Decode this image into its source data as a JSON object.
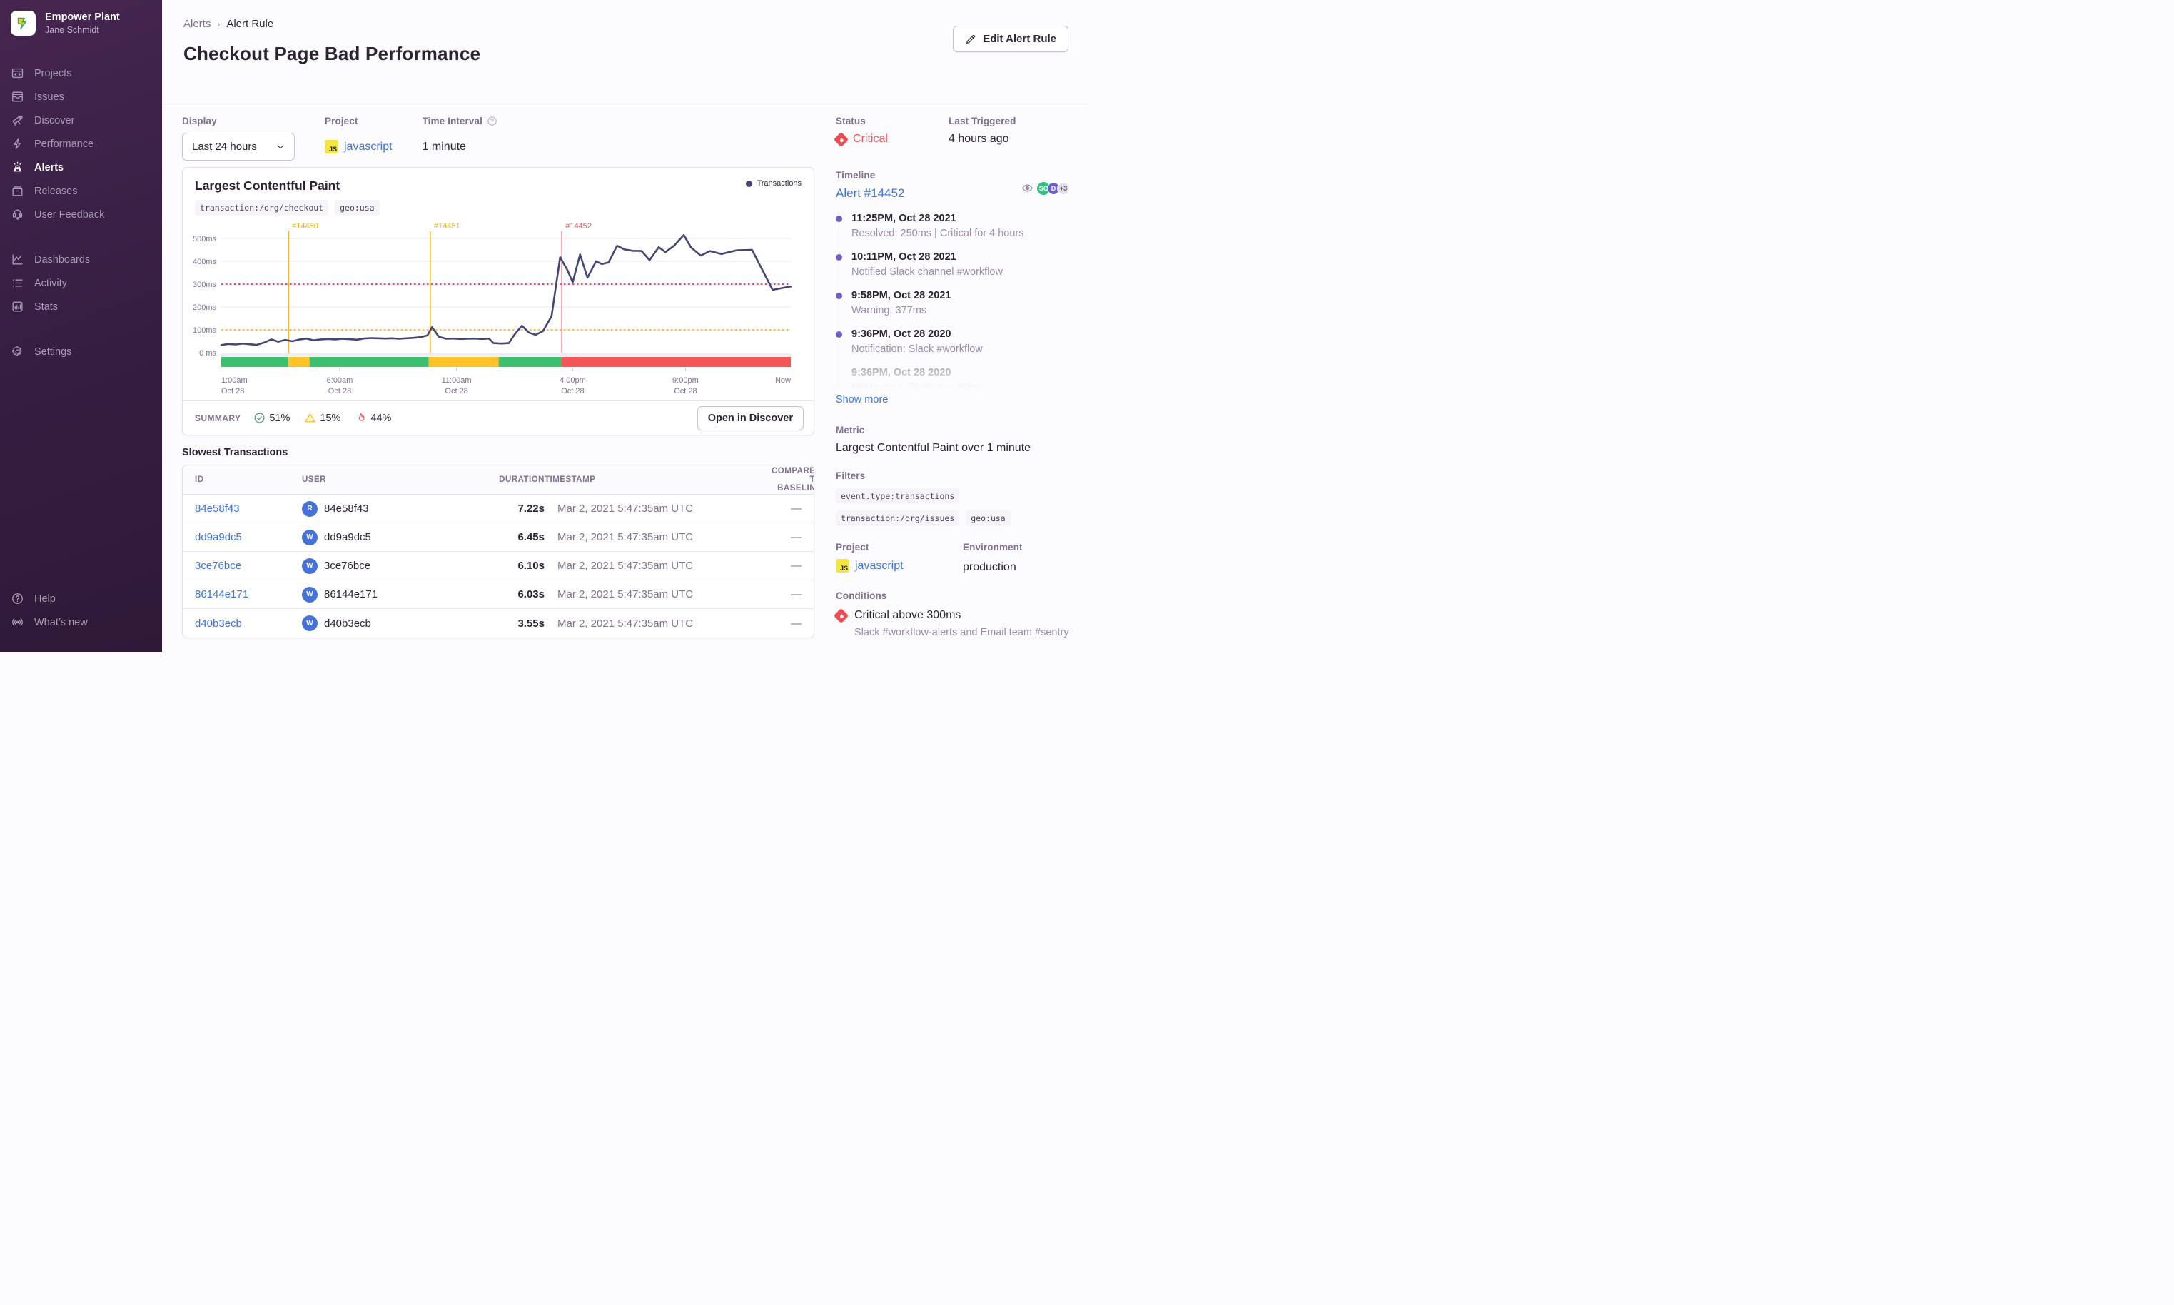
{
  "sidebar": {
    "org_name": "Empower Plant",
    "user_name": "Jane Schmidt",
    "primary_items": [
      {
        "label": "Projects",
        "icon": "projects-icon",
        "active": false
      },
      {
        "label": "Issues",
        "icon": "issues-icon",
        "active": false
      },
      {
        "label": "Discover",
        "icon": "discover-icon",
        "active": false
      },
      {
        "label": "Performance",
        "icon": "performance-icon",
        "active": false
      },
      {
        "label": "Alerts",
        "icon": "alerts-icon",
        "active": true
      },
      {
        "label": "Releases",
        "icon": "releases-icon",
        "active": false
      },
      {
        "label": "User Feedback",
        "icon": "user-feedback-icon",
        "active": false
      }
    ],
    "secondary_items": [
      {
        "label": "Dashboards",
        "icon": "dashboards-icon",
        "active": false
      },
      {
        "label": "Activity",
        "icon": "activity-icon",
        "active": false
      },
      {
        "label": "Stats",
        "icon": "stats-icon",
        "active": false
      }
    ],
    "settings_items": [
      {
        "label": "Settings",
        "icon": "settings-icon",
        "active": false
      }
    ],
    "footer_items": [
      {
        "label": "Help",
        "icon": "help-icon",
        "active": false
      },
      {
        "label": "What’s new",
        "icon": "whats-new-icon",
        "active": false
      }
    ]
  },
  "header": {
    "breadcrumb_parent": "Alerts",
    "breadcrumb_current": "Alert Rule",
    "title": "Checkout Page Bad Performance",
    "edit_button_label": "Edit Alert Rule"
  },
  "controls": {
    "display_label": "Display",
    "display_value": "Last 24 hours",
    "project_label": "Project",
    "project_badge": "JS",
    "project_value": "javascript",
    "interval_label": "Time Interval",
    "interval_value": "1 minute"
  },
  "status_panel": {
    "status_label": "Status",
    "status_value": "Critical",
    "last_triggered_label": "Last Triggered",
    "last_triggered_value": "4 hours ago"
  },
  "chart_card": {
    "title": "Largest Contentful Paint",
    "tags": [
      "transaction:/org/checkout",
      "geo:usa"
    ],
    "legend_label": "Transactions",
    "summary_label": "SUMMARY",
    "summary_ok": "51%",
    "summary_warning": "15%",
    "summary_critical": "44%",
    "open_button_label": "Open in Discover"
  },
  "chart_data": {
    "type": "line",
    "title": "Largest Contentful Paint",
    "ylabel": "ms",
    "ylim": [
      0,
      560
    ],
    "yticks": [
      {
        "value": 0,
        "label": "0 ms"
      },
      {
        "value": 100,
        "label": "100ms"
      },
      {
        "value": 200,
        "label": "200ms"
      },
      {
        "value": 300,
        "label": "300ms"
      },
      {
        "value": 400,
        "label": "400ms"
      },
      {
        "value": 500,
        "label": "500ms"
      }
    ],
    "xticks": [
      {
        "x": 0.0,
        "label": "1:00am",
        "sublabel": "Oct 28"
      },
      {
        "x": 0.208,
        "label": "6:00am",
        "sublabel": "Oct 28"
      },
      {
        "x": 0.413,
        "label": "11:00am",
        "sublabel": "Oct 28"
      },
      {
        "x": 0.617,
        "label": "4:00pm",
        "sublabel": "Oct 28"
      },
      {
        "x": 0.815,
        "label": "9:00pm",
        "sublabel": "Oct 28"
      },
      {
        "x": 1.0,
        "label": "Now",
        "sublabel": ""
      }
    ],
    "thresholds": {
      "critical_ms": 300,
      "warning_ms": 100
    },
    "incidents": [
      {
        "id": "#14450",
        "x": 0.118,
        "severity": "warning"
      },
      {
        "id": "#14451",
        "x": 0.367,
        "severity": "warning"
      },
      {
        "id": "#14452",
        "x": 0.598,
        "severity": "critical"
      }
    ],
    "status_band": [
      {
        "from": 0.0,
        "to": 0.118,
        "state": "ok"
      },
      {
        "from": 0.118,
        "to": 0.155,
        "state": "warning"
      },
      {
        "from": 0.155,
        "to": 0.364,
        "state": "ok"
      },
      {
        "from": 0.364,
        "to": 0.487,
        "state": "warning"
      },
      {
        "from": 0.487,
        "to": 0.597,
        "state": "ok"
      },
      {
        "from": 0.597,
        "to": 1.0,
        "state": "critical"
      }
    ],
    "series": [
      {
        "name": "Transactions",
        "points": [
          [
            0.0,
            33
          ],
          [
            0.012,
            38
          ],
          [
            0.025,
            36
          ],
          [
            0.038,
            40
          ],
          [
            0.05,
            37
          ],
          [
            0.062,
            34
          ],
          [
            0.075,
            44
          ],
          [
            0.088,
            58
          ],
          [
            0.1,
            48
          ],
          [
            0.112,
            56
          ],
          [
            0.125,
            50
          ],
          [
            0.138,
            58
          ],
          [
            0.15,
            62
          ],
          [
            0.162,
            54
          ],
          [
            0.175,
            58
          ],
          [
            0.188,
            60
          ],
          [
            0.2,
            58
          ],
          [
            0.212,
            61
          ],
          [
            0.225,
            59
          ],
          [
            0.238,
            57
          ],
          [
            0.25,
            62
          ],
          [
            0.262,
            64
          ],
          [
            0.275,
            63
          ],
          [
            0.288,
            62
          ],
          [
            0.3,
            63
          ],
          [
            0.312,
            61
          ],
          [
            0.325,
            63
          ],
          [
            0.338,
            65
          ],
          [
            0.35,
            68
          ],
          [
            0.362,
            76
          ],
          [
            0.37,
            112
          ],
          [
            0.382,
            70
          ],
          [
            0.395,
            61
          ],
          [
            0.408,
            62
          ],
          [
            0.42,
            60
          ],
          [
            0.432,
            61
          ],
          [
            0.445,
            62
          ],
          [
            0.458,
            60
          ],
          [
            0.47,
            62
          ],
          [
            0.478,
            42
          ],
          [
            0.492,
            40
          ],
          [
            0.505,
            42
          ],
          [
            0.515,
            80
          ],
          [
            0.528,
            118
          ],
          [
            0.54,
            88
          ],
          [
            0.552,
            78
          ],
          [
            0.565,
            95
          ],
          [
            0.58,
            160
          ],
          [
            0.595,
            418
          ],
          [
            0.608,
            360
          ],
          [
            0.617,
            308
          ],
          [
            0.63,
            430
          ],
          [
            0.643,
            328
          ],
          [
            0.658,
            400
          ],
          [
            0.668,
            388
          ],
          [
            0.68,
            395
          ],
          [
            0.695,
            468
          ],
          [
            0.708,
            452
          ],
          [
            0.722,
            446
          ],
          [
            0.738,
            445
          ],
          [
            0.752,
            405
          ],
          [
            0.768,
            462
          ],
          [
            0.78,
            440
          ],
          [
            0.795,
            468
          ],
          [
            0.812,
            515
          ],
          [
            0.825,
            460
          ],
          [
            0.842,
            425
          ],
          [
            0.858,
            445
          ],
          [
            0.878,
            432
          ],
          [
            0.905,
            448
          ],
          [
            0.932,
            450
          ],
          [
            0.968,
            275
          ],
          [
            1.0,
            290
          ]
        ]
      }
    ],
    "colors": {
      "line": "#444674",
      "grid": "#F0EDF3",
      "axis_text": "#80708F",
      "warning_line": "#FDB81B",
      "critical_line": "#D63964",
      "band_ok": "#3EBE6F",
      "band_warning": "#FFC227",
      "band_critical": "#F55459",
      "incident_warning": "#F5B000",
      "incident_critical": "#F2545B"
    },
    "legend": {
      "position": "top-right",
      "entries": [
        "Transactions"
      ]
    },
    "grid": true
  },
  "table": {
    "heading": "Slowest Transactions",
    "columns": [
      "ID",
      "USER",
      "DURATION",
      "TIMESTAMP",
      "COMPARED TO BASELINE"
    ],
    "rows": [
      {
        "id": "84e58f43",
        "avatar_letter": "R",
        "user": "84e58f43",
        "duration": "7.22s",
        "timestamp": "Mar 2, 2021 5:47:35am UTC",
        "baseline": "—"
      },
      {
        "id": "dd9a9dc5",
        "avatar_letter": "W",
        "user": "dd9a9dc5",
        "duration": "6.45s",
        "timestamp": "Mar 2, 2021 5:47:35am UTC",
        "baseline": "—"
      },
      {
        "id": "3ce76bce",
        "avatar_letter": "W",
        "user": "3ce76bce",
        "duration": "6.10s",
        "timestamp": "Mar 2, 2021 5:47:35am UTC",
        "baseline": "—"
      },
      {
        "id": "86144e171",
        "avatar_letter": "W",
        "user": "86144e171",
        "duration": "6.03s",
        "timestamp": "Mar 2, 2021 5:47:35am UTC",
        "baseline": "—"
      },
      {
        "id": "d40b3ecb",
        "avatar_letter": "W",
        "user": "d40b3ecb",
        "duration": "3.55s",
        "timestamp": "Mar 2, 2021 5:47:35am UTC",
        "baseline": "—"
      }
    ]
  },
  "timeline": {
    "label": "Timeline",
    "alert_link": "Alert #14452",
    "avatars": [
      {
        "text": "SC",
        "color": "green"
      },
      {
        "text": "D",
        "color": "purple"
      },
      {
        "text": "+3",
        "color": "gray"
      }
    ],
    "entries": [
      {
        "time": "11:25PM, Oct 28 2021",
        "desc": "Resolved: 250ms | Critical for 4 hours",
        "faded": false
      },
      {
        "time": "10:11PM, Oct 28 2021",
        "desc": "Notified Slack channel #workflow",
        "faded": false
      },
      {
        "time": "9:58PM, Oct 28 2021",
        "desc": "Warning: 377ms",
        "faded": false
      },
      {
        "time": "9:36PM, Oct 28 2020",
        "desc": "Notification: Slack #workflow",
        "faded": false
      },
      {
        "time": "9:36PM, Oct 28 2020",
        "desc": "Notification: Slack #workflow",
        "faded": true
      }
    ],
    "show_more_label": "Show more"
  },
  "details": {
    "metric_label": "Metric",
    "metric_value": "Largest Contentful Paint over 1 minute",
    "filters_label": "Filters",
    "filters": [
      "event.type:transactions",
      "transaction:/org/issues",
      "geo:usa"
    ],
    "project_label": "Project",
    "project_badge": "JS",
    "project_value": "javascript",
    "environment_label": "Environment",
    "environment_value": "production",
    "conditions_label": "Conditions",
    "condition_title": "Critical above 300ms",
    "condition_sub": "Slack #workflow-alerts and Email team #sentry"
  }
}
